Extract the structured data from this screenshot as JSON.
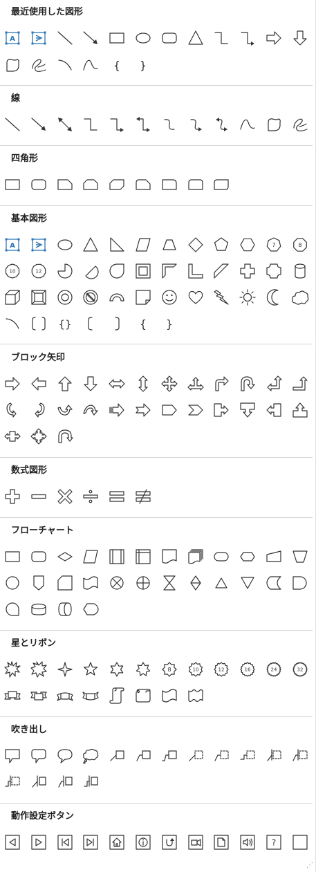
{
  "sections": [
    {
      "title": "最近使用した図形",
      "rows": [
        [
          "textbox-a-icon",
          "vertical-textbox-icon",
          "line-icon",
          "arrow-line-icon",
          "rectangle-icon",
          "oval-icon",
          "rounded-rectangle-icon",
          "triangle-icon",
          "elbow-connector-icon",
          "elbow-arrow-connector-icon",
          "right-arrow-icon",
          "down-arrow-icon"
        ],
        [
          "freeform-shape-icon",
          "scribble-icon",
          "arc-icon",
          "curve-icon",
          "left-brace-icon",
          "right-brace-icon"
        ]
      ]
    },
    {
      "title": "線",
      "rows": [
        [
          "line-icon",
          "arrow-line-icon",
          "double-arrow-line-icon",
          "elbow-connector-icon",
          "elbow-arrow-connector-icon",
          "elbow-double-arrow-connector-icon",
          "curved-connector-icon",
          "curved-arrow-connector-icon",
          "curved-double-arrow-connector-icon",
          "curve-icon",
          "freeform-shape-icon",
          "scribble-icon"
        ]
      ]
    },
    {
      "title": "四角形",
      "rows": [
        [
          "rectangle-icon",
          "rounded-rectangle-icon",
          "snip-single-corner-rectangle-icon",
          "snip-same-side-rectangle-icon",
          "snip-diagonal-rectangle-icon",
          "snip-round-rectangle-icon",
          "round-single-corner-rectangle-icon",
          "round-same-side-rectangle-icon",
          "round-diagonal-rectangle-icon"
        ]
      ]
    },
    {
      "title": "基本図形",
      "rows": [
        [
          "textbox-a-icon",
          "vertical-textbox-icon",
          "oval-icon",
          "triangle-icon",
          "right-triangle-icon",
          "parallelogram-icon",
          "trapezoid-icon",
          "diamond-icon",
          "pentagon-icon",
          "hexagon-icon",
          "heptagon-icon",
          "octagon-icon"
        ],
        [
          "decagon-icon",
          "dodecagon-icon",
          "pie-icon",
          "chord-icon",
          "teardrop-icon",
          "frame-icon",
          "half-frame-icon",
          "l-shape-icon",
          "diagonal-stripe-icon",
          "cross-icon",
          "plaque-icon",
          "can-icon"
        ],
        [
          "cube-icon",
          "bevel-icon",
          "donut-icon",
          "no-symbol-icon",
          "block-arc-icon",
          "folded-corner-icon",
          "smiley-face-icon",
          "heart-icon",
          "lightning-bolt-icon",
          "sun-icon",
          "moon-icon",
          "cloud-icon"
        ],
        [
          "arc-icon",
          "double-bracket-icon",
          "double-brace-icon",
          "left-bracket-icon",
          "right-bracket-icon",
          "left-brace-icon",
          "right-brace-icon"
        ]
      ]
    },
    {
      "title": "ブロック矢印",
      "rows": [
        [
          "right-arrow-icon",
          "left-arrow-icon",
          "up-arrow-icon",
          "down-arrow-icon",
          "left-right-arrow-icon",
          "up-down-arrow-icon",
          "quad-arrow-icon",
          "left-right-up-arrow-icon",
          "bent-arrow-icon",
          "u-turn-arrow-icon",
          "left-up-arrow-icon",
          "bent-up-arrow-icon"
        ],
        [
          "curved-right-arrow-icon",
          "curved-left-arrow-icon",
          "curved-up-arrow-icon",
          "curved-down-arrow-icon",
          "striped-right-arrow-icon",
          "notched-right-arrow-icon",
          "pentagon-arrow-icon",
          "chevron-icon",
          "right-arrow-callout-icon",
          "down-arrow-callout-icon",
          "left-arrow-callout-icon",
          "up-arrow-callout-icon"
        ],
        [
          "left-right-arrow-callout-icon",
          "quad-arrow-callout-icon",
          "circular-arrow-icon"
        ]
      ]
    },
    {
      "title": "数式図形",
      "rows": [
        [
          "plus-icon",
          "minus-icon",
          "multiply-icon",
          "division-icon",
          "equal-icon",
          "not-equal-icon"
        ]
      ]
    },
    {
      "title": "フローチャート",
      "rows": [
        [
          "flowchart-process-icon",
          "flowchart-alternate-process-icon",
          "flowchart-decision-icon",
          "flowchart-data-icon",
          "flowchart-predefined-process-icon",
          "flowchart-internal-storage-icon",
          "flowchart-document-icon",
          "flowchart-multidocument-icon",
          "flowchart-terminator-icon",
          "flowchart-preparation-icon",
          "flowchart-manual-input-icon",
          "flowchart-manual-operation-icon"
        ],
        [
          "flowchart-connector-icon",
          "flowchart-offpage-connector-icon",
          "flowchart-card-icon",
          "flowchart-punched-tape-icon",
          "flowchart-summing-junction-icon",
          "flowchart-or-icon",
          "flowchart-collate-icon",
          "flowchart-sort-icon",
          "flowchart-extract-icon",
          "flowchart-merge-icon",
          "flowchart-stored-data-icon",
          "flowchart-delay-icon"
        ],
        [
          "flowchart-sequential-access-storage-icon",
          "flowchart-magnetic-disk-icon",
          "flowchart-direct-access-storage-icon",
          "flowchart-display-icon"
        ]
      ]
    },
    {
      "title": "星とリボン",
      "rows": [
        [
          "explosion-1-icon",
          "explosion-2-icon",
          "star-4-point-icon",
          "star-5-point-icon",
          "star-6-point-icon",
          "star-7-point-icon",
          "star-8-point-icon",
          "star-10-point-icon",
          "star-12-point-icon",
          "star-16-point-icon",
          "star-24-point-icon",
          "star-32-point-icon"
        ],
        [
          "ribbon-up-icon",
          "ribbon-down-icon",
          "curved-ribbon-up-icon",
          "curved-ribbon-down-icon",
          "vertical-scroll-icon",
          "horizontal-scroll-icon",
          "wave-icon",
          "double-wave-icon"
        ]
      ]
    },
    {
      "title": "吹き出し",
      "rows": [
        [
          "rectangular-callout-icon",
          "rounded-rectangular-callout-icon",
          "oval-callout-icon",
          "cloud-callout-icon",
          "line-callout-1-icon",
          "line-callout-2-icon",
          "line-callout-3-icon",
          "line-callout-1-no-border-icon",
          "line-callout-2-no-border-icon",
          "line-callout-3-no-border-icon",
          "line-callout-1-accent-bar-icon",
          "line-callout-2-accent-bar-icon"
        ],
        [
          "line-callout-3-accent-bar-icon",
          "line-callout-1-border-accent-icon",
          "line-callout-2-border-accent-icon",
          "line-callout-3-border-accent-icon"
        ]
      ]
    },
    {
      "title": "動作設定ボタン",
      "rows": [
        [
          "action-button-back-icon",
          "action-button-forward-icon",
          "action-button-beginning-icon",
          "action-button-end-icon",
          "action-button-home-icon",
          "action-button-information-icon",
          "action-button-return-icon",
          "action-button-movie-icon",
          "action-button-document-icon",
          "action-button-sound-icon",
          "action-button-help-icon",
          "action-button-custom-icon"
        ]
      ]
    }
  ],
  "labels": {
    "heptagon-icon": "7",
    "octagon-icon": "8",
    "decagon-icon": "10",
    "dodecagon-icon": "12",
    "star-8-point-icon": "8",
    "star-10-point-icon": "10",
    "star-12-point-icon": "12",
    "star-16-point-icon": "16",
    "star-24-point-icon": "24",
    "star-32-point-icon": "32",
    "action-button-help-icon": "?"
  },
  "colors": {
    "stroke": "#333333",
    "accent": "#2e75b6",
    "divider": "#d4d4d4"
  }
}
